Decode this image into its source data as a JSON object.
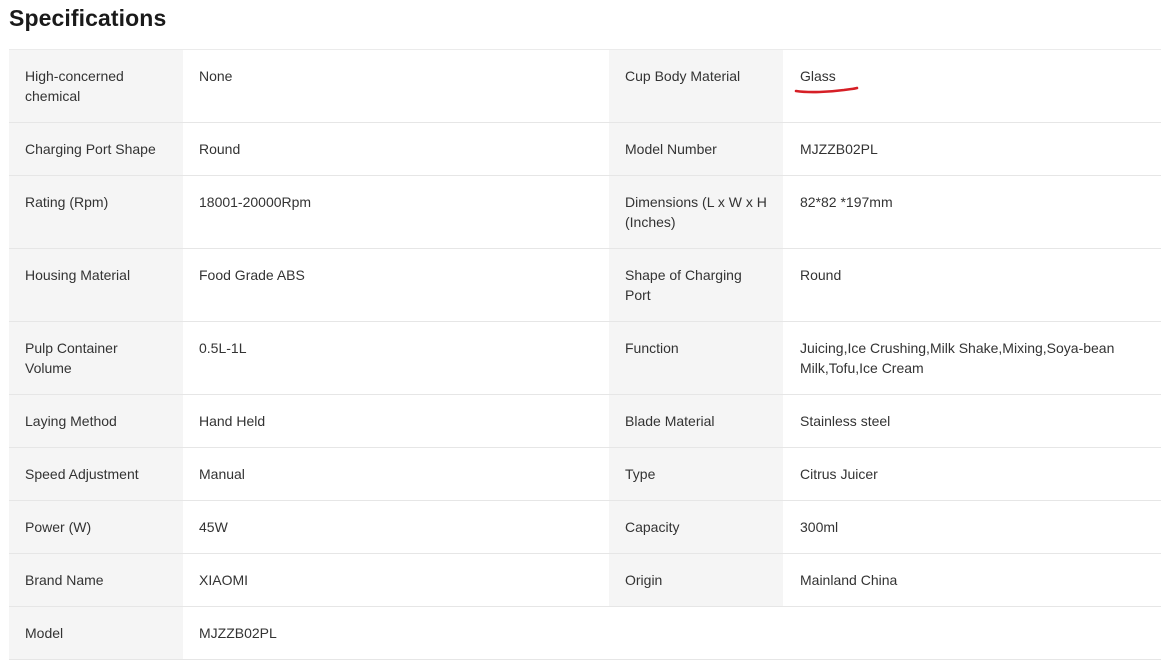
{
  "page": {
    "title": "Specifications"
  },
  "specs": [
    {
      "k1": "High-concerned chemical",
      "v1": "None",
      "k2": "Cup Body Material",
      "v2": "Glass"
    },
    {
      "k1": "Charging Port Shape",
      "v1": "Round",
      "k2": "Model Number",
      "v2": "MJZZB02PL"
    },
    {
      "k1": "Rating (Rpm)",
      "v1": "18001-20000Rpm",
      "k2": "Dimensions (L x W x H (Inches)",
      "v2": "82*82 *197mm"
    },
    {
      "k1": "Housing Material",
      "v1": "Food Grade ABS",
      "k2": "Shape of Charging Port",
      "v2": "Round"
    },
    {
      "k1": "Pulp Container Volume",
      "v1": "0.5L-1L",
      "k2": "Function",
      "v2": "Juicing,Ice Crushing,Milk Shake,Mixing,Soya-bean Milk,Tofu,Ice Cream"
    },
    {
      "k1": "Laying Method",
      "v1": "Hand Held",
      "k2": "Blade Material",
      "v2": "Stainless steel"
    },
    {
      "k1": "Speed Adjustment",
      "v1": "Manual",
      "k2": "Type",
      "v2": "Citrus Juicer"
    },
    {
      "k1": "Power (W)",
      "v1": "45W",
      "k2": "Capacity",
      "v2": "300ml"
    },
    {
      "k1": "Brand Name",
      "v1": "XIAOMI",
      "k2": "Origin",
      "v2": "Mainland China"
    },
    {
      "k1": "Model",
      "v1": "MJZZB02PL"
    }
  ],
  "annotation": {
    "underline_color": "#d61f26"
  }
}
